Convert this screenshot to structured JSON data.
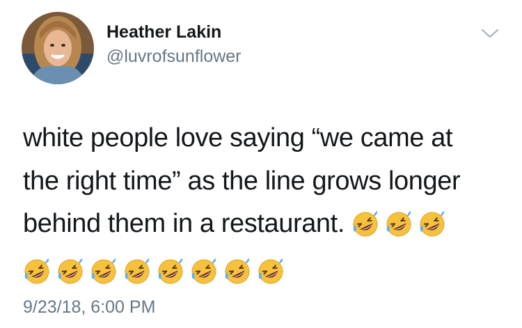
{
  "author": {
    "display_name": "Heather Lakin",
    "handle": "@luvrofsunflower",
    "avatar_icon": "profile-photo"
  },
  "menu": {
    "icon": "chevron-down-icon"
  },
  "tweet": {
    "line1": "white people love saying “we came at",
    "line2": "the right time” as the line grows longer",
    "line3": "behind them in a restaurant.",
    "emoji": "🤣",
    "emoji_count_line3": 3,
    "emoji_count_line4": 8
  },
  "timestamp": "9/23/18, 6:00 PM",
  "colors": {
    "text": "#14171a",
    "secondary": "#657786",
    "emoji_face": "#f6c23e"
  }
}
